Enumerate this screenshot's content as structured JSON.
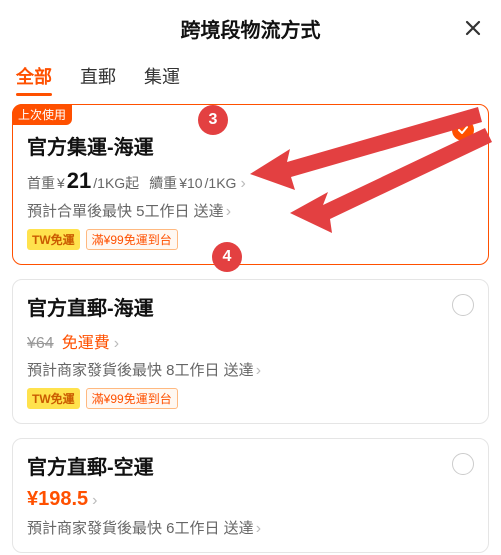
{
  "header": {
    "title": "跨境段物流方式"
  },
  "tabs": {
    "items": [
      {
        "label": "全部",
        "active": true
      },
      {
        "label": "直郵",
        "active": false
      },
      {
        "label": "集運",
        "active": false
      }
    ]
  },
  "cards": [
    {
      "last_used": "上次使用",
      "title": "官方集運-海運",
      "price": {
        "prefix": "首重",
        "currency": "¥",
        "main": "21",
        "unit": "/1KG起",
        "renew_label": "續重",
        "renew_price": "¥10",
        "renew_unit": "/1KG"
      },
      "delivery": "預計合單後最快 5工作日 送達",
      "badge_tw": "TW免運",
      "badge_promo": "滿¥99免運到台",
      "selected": true
    },
    {
      "title": "官方直郵-海運",
      "strike_price": "¥64",
      "free_ship": "免運費",
      "delivery": "預計商家發貨後最快 8工作日 送達",
      "badge_tw": "TW免運",
      "badge_promo": "滿¥99免運到台",
      "selected": false
    },
    {
      "title": "官方直郵-空運",
      "price_simple": "¥198.5",
      "delivery": "預計商家發貨後最快 6工作日 送達",
      "selected": false
    }
  ],
  "annotations": {
    "n3": "3",
    "n4": "4"
  }
}
